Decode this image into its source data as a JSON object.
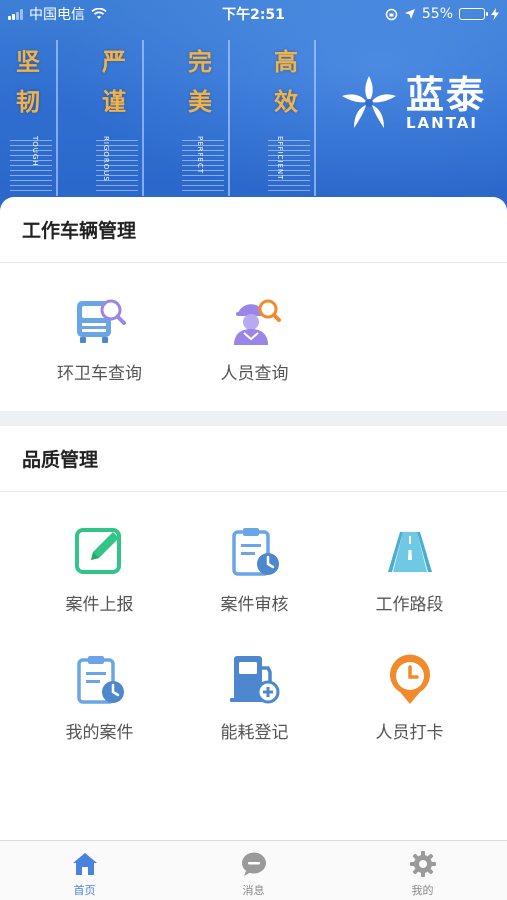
{
  "status_bar": {
    "carrier": "中国电信",
    "time": "下午2:51",
    "battery": "55%",
    "battery_level": 0.55
  },
  "banner": {
    "posters": [
      {
        "chars": [
          "坚",
          "韧"
        ],
        "en": "TOUGH"
      },
      {
        "chars": [
          "严",
          "谨"
        ],
        "en": "RIGOROUS"
      },
      {
        "chars": [
          "完",
          "美"
        ],
        "en": "PERFECT"
      },
      {
        "chars": [
          "高",
          "效"
        ],
        "en": "EFFICIENT"
      }
    ],
    "logo_cn": "蓝泰",
    "logo_en": "LANTAI"
  },
  "sections": {
    "vehicle": {
      "title": "工作车辆管理",
      "items": [
        {
          "label": "环卫车查询",
          "icon": "sanitation-truck-search-icon"
        },
        {
          "label": "人员查询",
          "icon": "worker-search-icon"
        }
      ]
    },
    "quality": {
      "title": "品质管理",
      "items": [
        {
          "label": "案件上报",
          "icon": "edit-report-icon"
        },
        {
          "label": "案件审核",
          "icon": "clipboard-clock-icon"
        },
        {
          "label": "工作路段",
          "icon": "road-icon"
        },
        {
          "label": "我的案件",
          "icon": "my-cases-icon"
        },
        {
          "label": "能耗登记",
          "icon": "fuel-pump-icon"
        },
        {
          "label": "人员打卡",
          "icon": "clock-pin-icon"
        }
      ]
    }
  },
  "tabbar": {
    "tabs": [
      {
        "label": "首页",
        "icon": "home-icon",
        "active": true
      },
      {
        "label": "消息",
        "icon": "message-icon",
        "active": false
      },
      {
        "label": "我的",
        "icon": "gear-icon",
        "active": false
      }
    ]
  },
  "colors": {
    "banner_blue": "#2f6ed0",
    "accent_blue": "#4a82e0",
    "green": "#33c48a",
    "light_blue": "#6aa6e6",
    "purple": "#9b85e8",
    "orange": "#f08a2a",
    "poster_gold": "#f1b24a"
  }
}
